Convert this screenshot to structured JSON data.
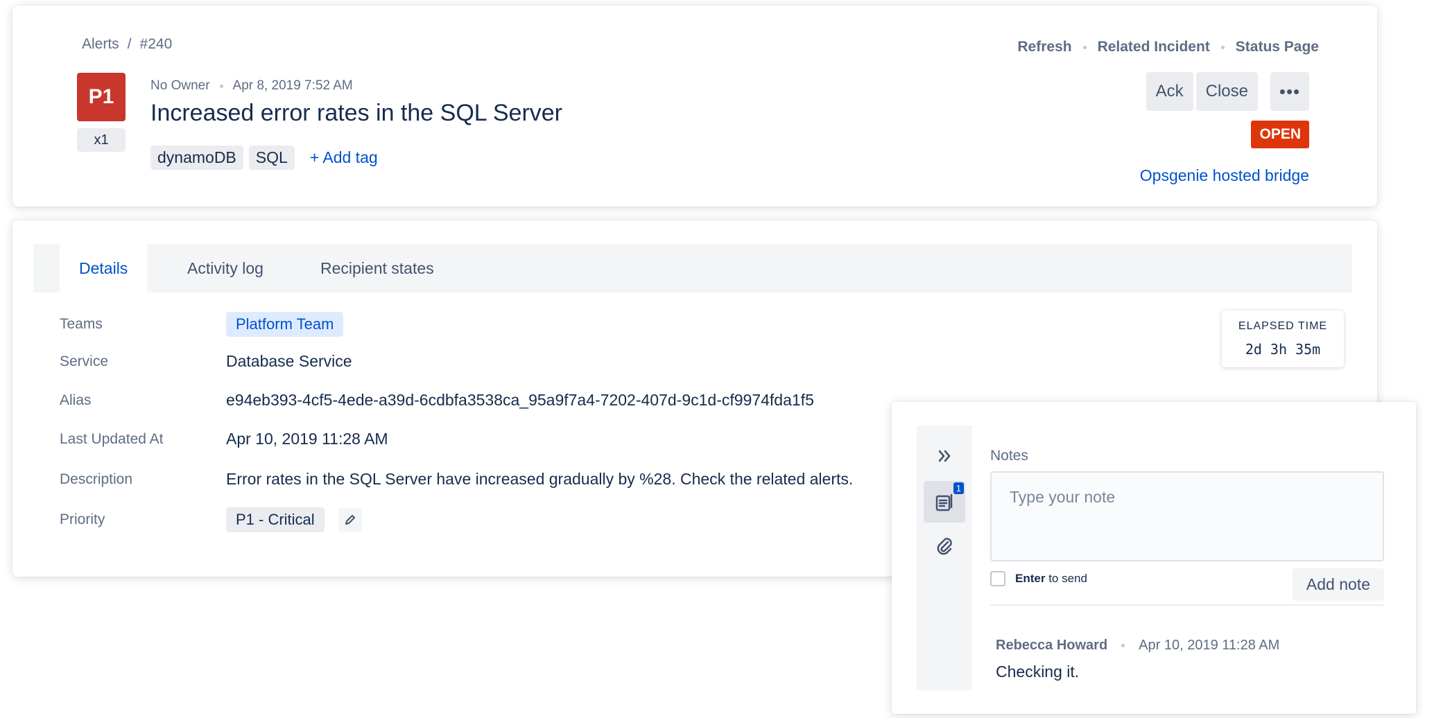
{
  "breadcrumb": {
    "root": "Alerts",
    "separator": "/",
    "current": "#240"
  },
  "alert": {
    "priority": "P1",
    "count": "x1",
    "owner": "No Owner",
    "created_at": "Apr 8, 2019 7:52 AM",
    "title": "Increased error rates in the SQL Server",
    "tags": [
      "dynamoDB",
      "SQL"
    ],
    "add_tag_label": "+ Add tag",
    "status": "OPEN",
    "bridge_link": "Opsgenie hosted bridge"
  },
  "top_links": {
    "refresh": "Refresh",
    "related_incident": "Related Incident",
    "status_page": "Status Page"
  },
  "actions": {
    "ack": "Ack",
    "close": "Close",
    "more": "•••"
  },
  "tabs": [
    {
      "label": "Details",
      "active": true
    },
    {
      "label": "Activity log",
      "active": false
    },
    {
      "label": "Recipient states",
      "active": false
    }
  ],
  "details": {
    "teams_label": "Teams",
    "teams_value": "Platform Team",
    "service_label": "Service",
    "service_value": "Database Service",
    "alias_label": "Alias",
    "alias_value": "e94eb393-4cf5-4ede-a39d-6cdbfa3538ca_95a9f7a4-7202-407d-9c1d-cf9974fda1f5",
    "updated_label": "Last Updated At",
    "updated_value": "Apr 10, 2019 11:28 AM",
    "description_label": "Description",
    "description_value": "Error rates in the SQL Server have increased gradually by %28. Check the related alerts.",
    "priority_label": "Priority",
    "priority_value": "P1 - Critical"
  },
  "elapsed": {
    "label": "ELAPSED TIME",
    "value": "2d  3h  35m"
  },
  "notes": {
    "label": "Notes",
    "placeholder": "Type your note",
    "enter_key": "Enter",
    "enter_suffix": "to send",
    "add_button": "Add note",
    "badge": "1",
    "entry": {
      "author": "Rebecca Howard",
      "time": "Apr 10, 2019 11:28 AM",
      "text": "Checking it."
    }
  },
  "colors": {
    "p1": "#c9372c",
    "open": "#de350b",
    "link": "#0052cc"
  }
}
